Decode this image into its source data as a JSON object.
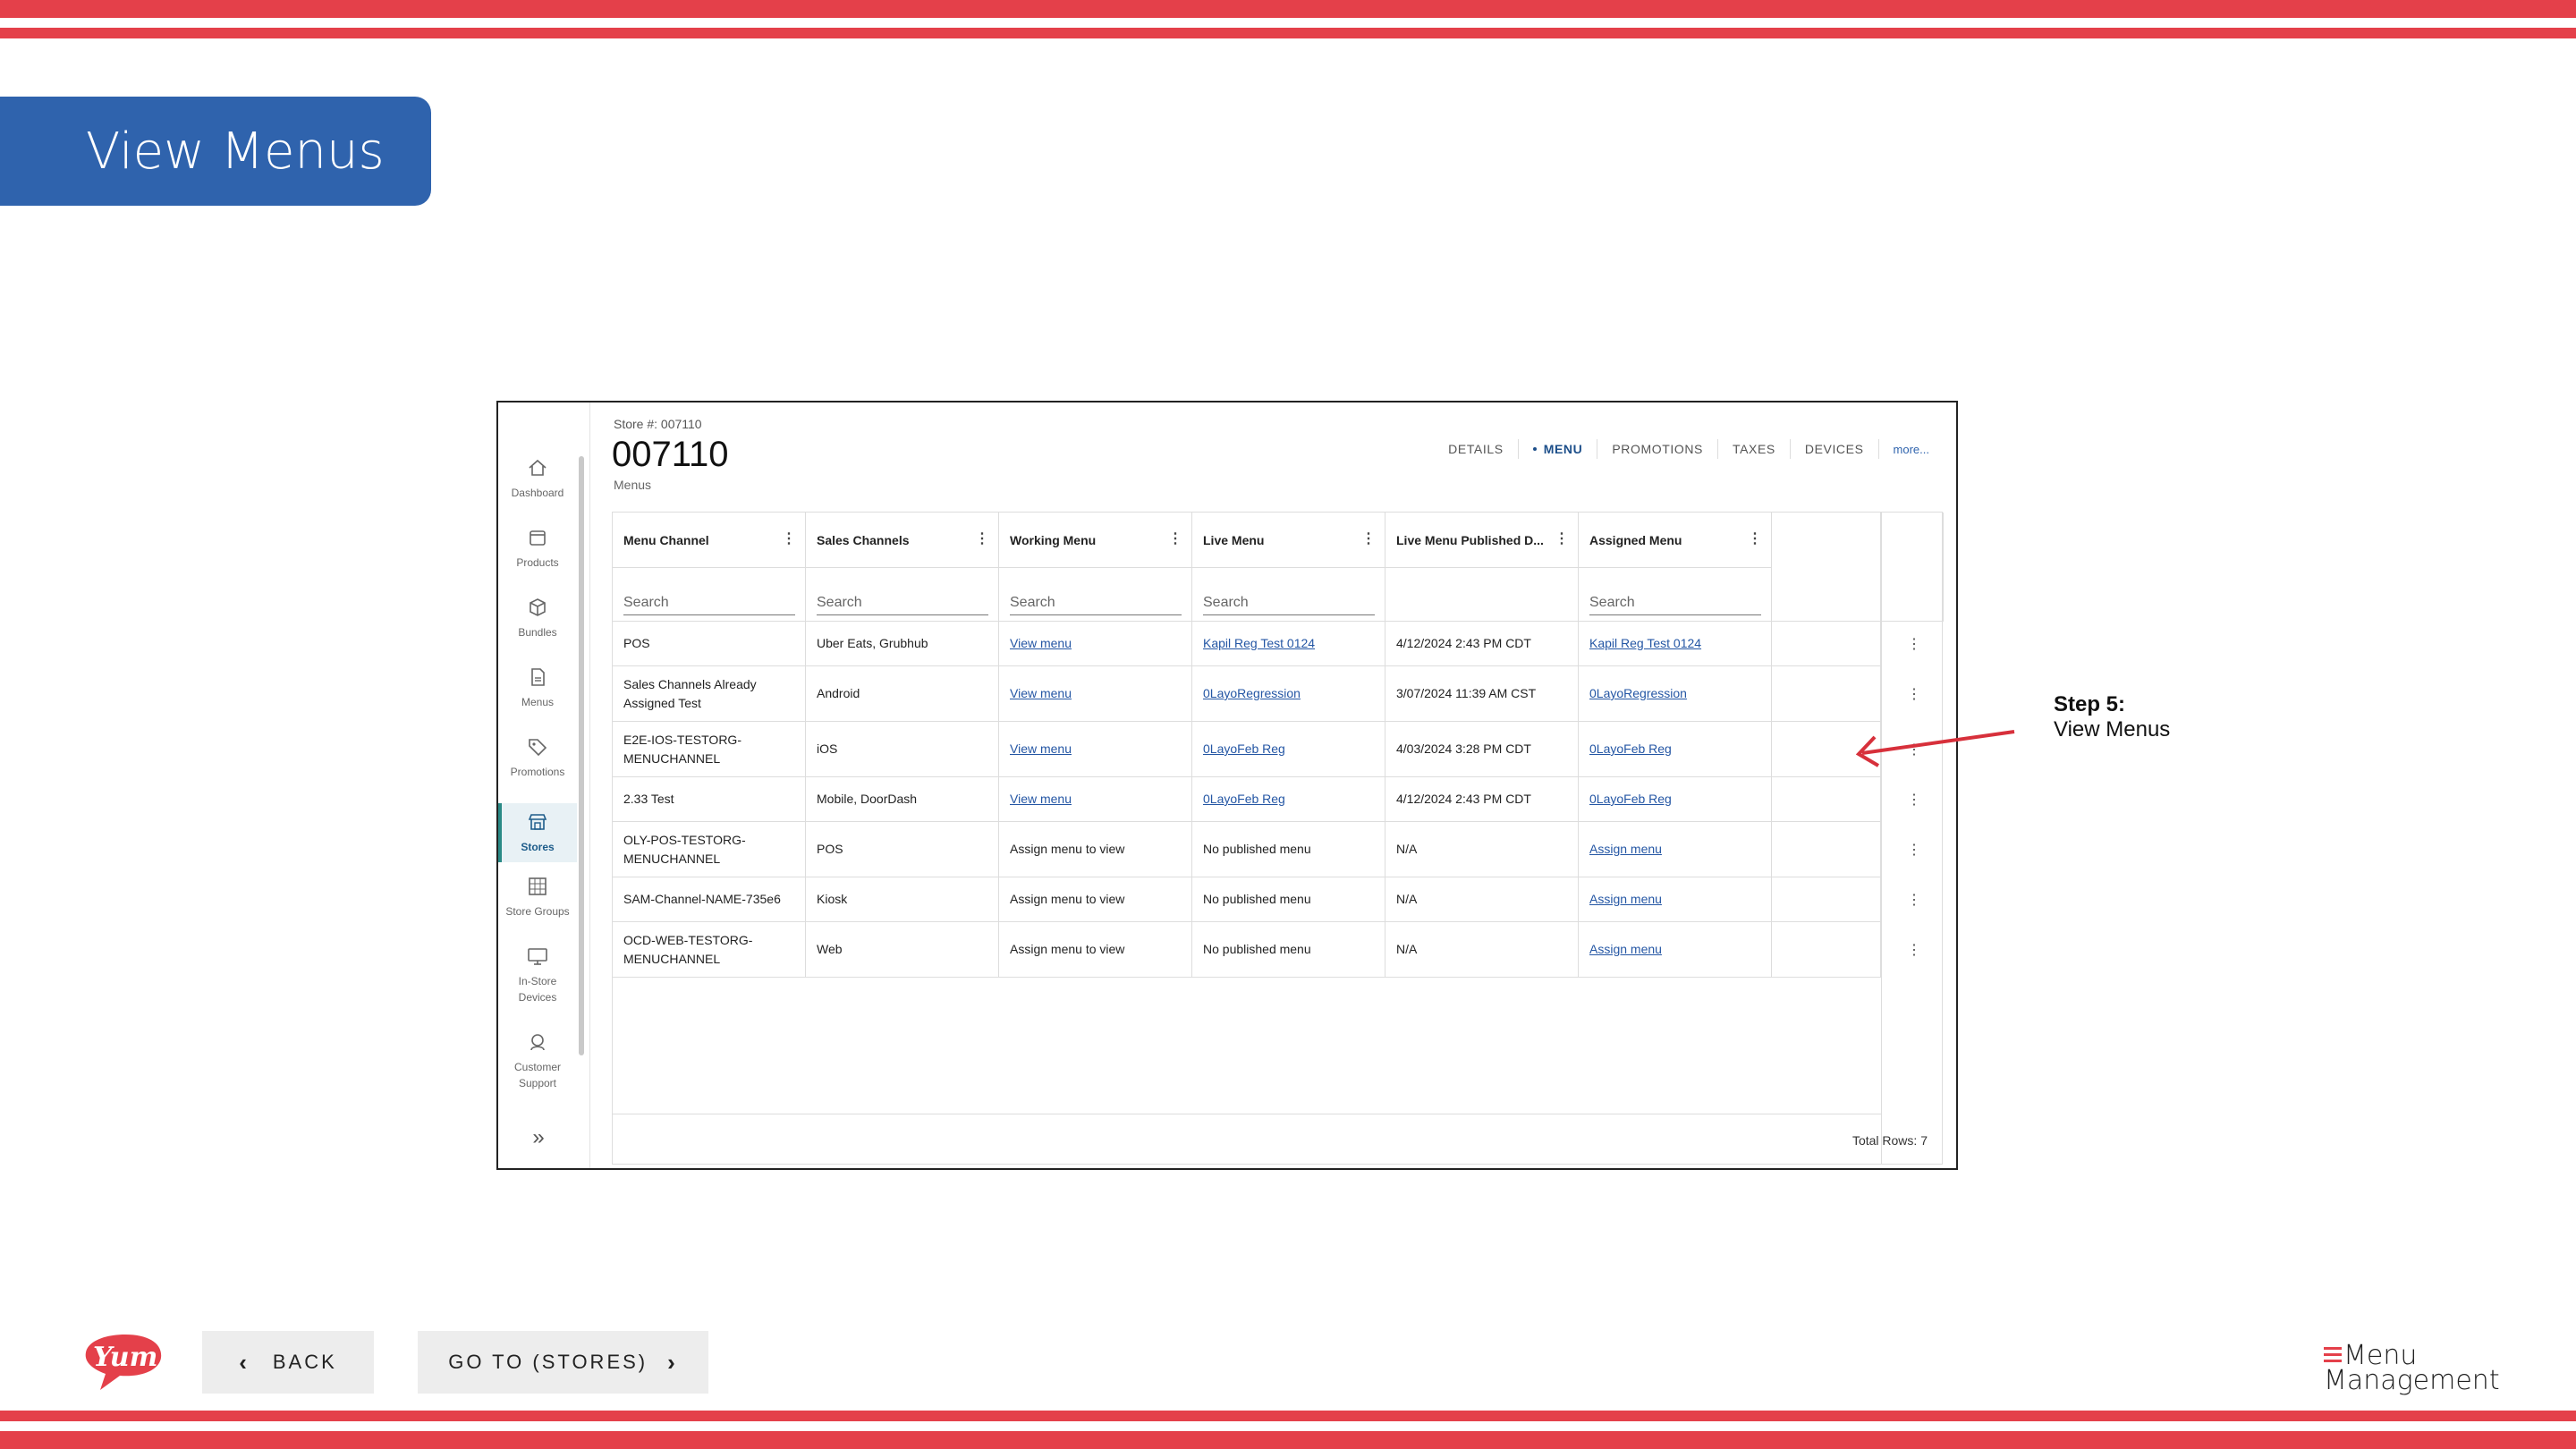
{
  "page": {
    "title": "View Menus",
    "step_label": "Step 5:",
    "step_text": "View Menus"
  },
  "colors": {
    "brand_red": "#e4404a",
    "title_blue": "#2f63ad",
    "link_blue": "#2456a4",
    "active_teal": "#2a8a86"
  },
  "sidebar": {
    "items": [
      {
        "label": "Dashboard",
        "icon": "home-icon"
      },
      {
        "label": "Products",
        "icon": "product-icon"
      },
      {
        "label": "Bundles",
        "icon": "cube-icon"
      },
      {
        "label": "Menus",
        "icon": "document-icon"
      },
      {
        "label": "Promotions",
        "icon": "tag-icon"
      },
      {
        "label": "Stores",
        "icon": "store-icon",
        "active": true
      },
      {
        "label": "Store Groups",
        "icon": "grid-icon"
      },
      {
        "label": "In-Store Devices",
        "label_lines": [
          "In-Store",
          "Devices"
        ],
        "icon": "monitor-icon"
      },
      {
        "label": "Customer Support",
        "label_lines": [
          "Customer",
          "Support"
        ],
        "icon": "headset-icon"
      }
    ],
    "expand_icon": "double-chevron-right-icon"
  },
  "store": {
    "label": "Store #: 007110",
    "number": "007110",
    "breadcrumb": "Menus"
  },
  "tabs": [
    "DETAILS",
    "MENU",
    "PROMOTIONS",
    "TAXES",
    "DEVICES",
    "more..."
  ],
  "active_tab": "MENU",
  "table": {
    "columns": [
      "Menu Channel",
      "Sales Channels",
      "Working Menu",
      "Live Menu",
      "Live Menu Published D...",
      "Assigned Menu"
    ],
    "search_placeholder": "Search",
    "rows": [
      [
        "POS",
        "Uber Eats, Grubhub",
        "View menu",
        "Kapil Reg Test 0124",
        "4/12/2024 2:43 PM CDT",
        "Kapil Reg Test 0124"
      ],
      [
        "Sales Channels Already Assigned Test",
        "Android",
        "View menu",
        "0LayoRegression",
        "3/07/2024 11:39 AM CST",
        "0LayoRegression"
      ],
      [
        "E2E-IOS-TESTORG-MENUCHANNEL",
        "iOS",
        "View menu",
        "0LayoFeb Reg",
        "4/03/2024 3:28 PM CDT",
        "0LayoFeb Reg"
      ],
      [
        "2.33 Test",
        "Mobile, DoorDash",
        "View menu",
        "0LayoFeb Reg",
        "4/12/2024 2:43 PM CDT",
        "0LayoFeb Reg"
      ],
      [
        "OLY-POS-TESTORG-MENUCHANNEL",
        "POS",
        "Assign menu to view",
        "No published menu",
        "N/A",
        "Assign menu"
      ],
      [
        "SAM-Channel-NAME-735e6",
        "Kiosk",
        "Assign menu to view",
        "No published menu",
        "N/A",
        "Assign menu"
      ],
      [
        "OCD-WEB-TESTORG-MENUCHANNEL",
        "Web",
        "Assign menu to view",
        "No published menu",
        "N/A",
        "Assign menu"
      ]
    ],
    "total_rows": "Total Rows: 7"
  },
  "footer": {
    "back_label": "BACK",
    "next_label": "GO TO (STORES)",
    "logo_text": "Yum!",
    "brand_line1": "Menu",
    "brand_line2": "Management"
  }
}
